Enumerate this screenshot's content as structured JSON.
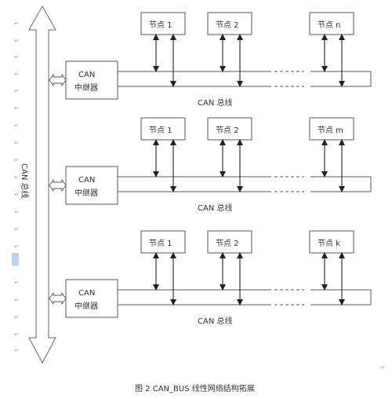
{
  "main_bus": {
    "label": "CAN 总线"
  },
  "segments": [
    {
      "repeater_label_line1": "CAN",
      "repeater_label_line2": "中继器",
      "bus_label": "CAN 总线",
      "nodes": [
        "节点 1",
        "节点 2",
        "节点 n"
      ]
    },
    {
      "repeater_label_line1": "CAN",
      "repeater_label_line2": "中继器",
      "bus_label": "CAN 总线",
      "nodes": [
        "节点 1",
        "节点 2",
        "节点 m"
      ]
    },
    {
      "repeater_label_line1": "CAN",
      "repeater_label_line2": "中继器",
      "bus_label": "CAN 总线",
      "nodes": [
        "节点 1",
        "节点 2",
        "节点 k"
      ]
    }
  ],
  "caption": "图 2 CAN_BUS 线性网络结构拓展",
  "paragraph_mark": "↵",
  "colors": {
    "line": "#333333",
    "outline": "#555555",
    "selection": "#b8d3f3"
  }
}
